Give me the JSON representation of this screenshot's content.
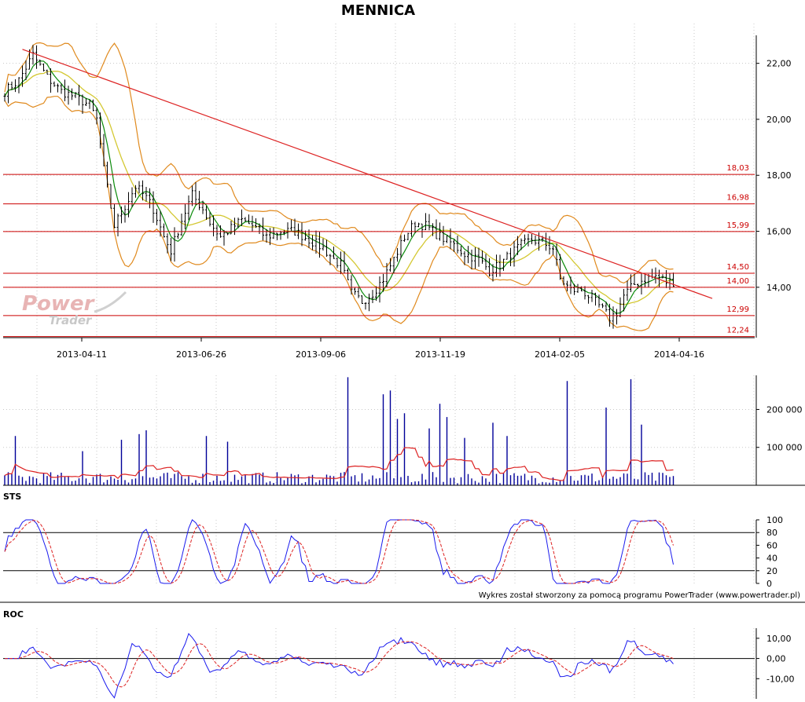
{
  "chart_data": [
    {
      "type": "candlestick",
      "title": "MENNICA",
      "x_labels": [
        "2013-04-11",
        "2013-06-26",
        "2013-09-06",
        "2013-11-19",
        "2014-02-05",
        "2014-04-16"
      ],
      "y_ticks": [
        "22,00",
        "20,00",
        "18,00",
        "16,00",
        "14,00"
      ],
      "ylim": [
        12.2,
        23.0
      ],
      "price_path": [
        [
          0,
          21.0
        ],
        [
          4,
          21.4
        ],
        [
          8,
          22.3
        ],
        [
          12,
          21.5
        ],
        [
          16,
          21.0
        ],
        [
          20,
          20.8
        ],
        [
          24,
          20.5
        ],
        [
          26,
          20.0
        ],
        [
          28,
          18.2
        ],
        [
          31,
          16.2
        ],
        [
          34,
          16.9
        ],
        [
          37,
          17.6
        ],
        [
          40,
          17.2
        ],
        [
          42,
          16.8
        ],
        [
          45,
          15.8
        ],
        [
          47,
          15.3
        ],
        [
          50,
          16.4
        ],
        [
          53,
          17.3
        ],
        [
          56,
          16.8
        ],
        [
          58,
          16.3
        ],
        [
          61,
          15.8
        ],
        [
          64,
          16.1
        ],
        [
          67,
          16.4
        ],
        [
          70,
          16.2
        ],
        [
          74,
          15.8
        ],
        [
          78,
          16.0
        ],
        [
          82,
          16.0
        ],
        [
          86,
          15.7
        ],
        [
          90,
          15.4
        ],
        [
          93,
          15.0
        ],
        [
          95,
          14.8
        ],
        [
          98,
          13.8
        ],
        [
          101,
          13.5
        ],
        [
          104,
          13.8
        ],
        [
          107,
          14.3
        ],
        [
          110,
          15.0
        ],
        [
          113,
          15.8
        ],
        [
          116,
          16.3
        ],
        [
          119,
          16.2
        ],
        [
          122,
          15.9
        ],
        [
          126,
          15.6
        ],
        [
          130,
          15.2
        ],
        [
          134,
          15.0
        ],
        [
          137,
          14.6
        ],
        [
          140,
          14.8
        ],
        [
          143,
          15.2
        ],
        [
          146,
          15.5
        ],
        [
          149,
          15.7
        ],
        [
          152,
          15.6
        ],
        [
          155,
          15.4
        ],
        [
          157,
          14.3
        ],
        [
          160,
          13.9
        ],
        [
          163,
          13.9
        ],
        [
          166,
          13.6
        ],
        [
          169,
          13.2
        ],
        [
          171,
          12.9
        ],
        [
          173,
          13.1
        ],
        [
          175,
          13.7
        ],
        [
          178,
          14.1
        ],
        [
          181,
          14.3
        ],
        [
          184,
          14.4
        ],
        [
          187,
          14.2
        ]
      ],
      "support_levels": [
        {
          "value": 18.03,
          "label": "18,03"
        },
        {
          "value": 16.98,
          "label": "16,98"
        },
        {
          "value": 15.99,
          "label": "15,99"
        },
        {
          "value": 14.5,
          "label": "14,50"
        },
        {
          "value": 14.0,
          "label": "14,00"
        },
        {
          "value": 12.99,
          "label": "12,99"
        },
        {
          "value": 12.24,
          "label": "12,24"
        }
      ],
      "trendline": {
        "start": [
          5,
          22.5
        ],
        "end": [
          200,
          13.6
        ]
      },
      "indicators": [
        "moving averages",
        "Bollinger bands",
        "trend line"
      ]
    },
    {
      "type": "bar",
      "y_ticks": [
        "200 000",
        "100 000"
      ],
      "ylim": [
        0,
        290000
      ],
      "volume_spikes": [
        [
          3,
          130000
        ],
        [
          22,
          90000
        ],
        [
          33,
          120000
        ],
        [
          38,
          135000
        ],
        [
          40,
          145000
        ],
        [
          57,
          130000
        ],
        [
          63,
          115000
        ],
        [
          97,
          285000
        ],
        [
          107,
          240000
        ],
        [
          109,
          250000
        ],
        [
          111,
          175000
        ],
        [
          113,
          190000
        ],
        [
          120,
          150000
        ],
        [
          123,
          215000
        ],
        [
          125,
          180000
        ],
        [
          130,
          125000
        ],
        [
          138,
          165000
        ],
        [
          142,
          130000
        ],
        [
          159,
          275000
        ],
        [
          170,
          205000
        ],
        [
          177,
          280000
        ],
        [
          180,
          160000
        ]
      ]
    },
    {
      "type": "line",
      "label": "STS",
      "y_ticks": [
        "100",
        "80",
        "60",
        "40",
        "20",
        "0"
      ],
      "ylim": [
        0,
        100
      ],
      "levels": [
        80,
        20
      ]
    },
    {
      "type": "line",
      "label": "ROC",
      "y_ticks": [
        "10,00",
        "0,00",
        "-10,00"
      ],
      "ylim": [
        -20,
        15
      ]
    }
  ],
  "credit": "Wykres został stworzony za pomocą programu PowerTrader (www.powertrader.pl)",
  "logo": {
    "word1": "Power",
    "word2": "Trader"
  },
  "colors": {
    "candle": "#000000",
    "bollinger": "#e08a1e",
    "ma_fast": "#0a8a0a",
    "ma_slow": "#d4c832",
    "level": "#cc0000",
    "trend": "#dd2222",
    "volume": "#000099",
    "volume_ma": "#dd2222",
    "osc": "#1a1aee",
    "osc_signal": "#dd2222"
  }
}
